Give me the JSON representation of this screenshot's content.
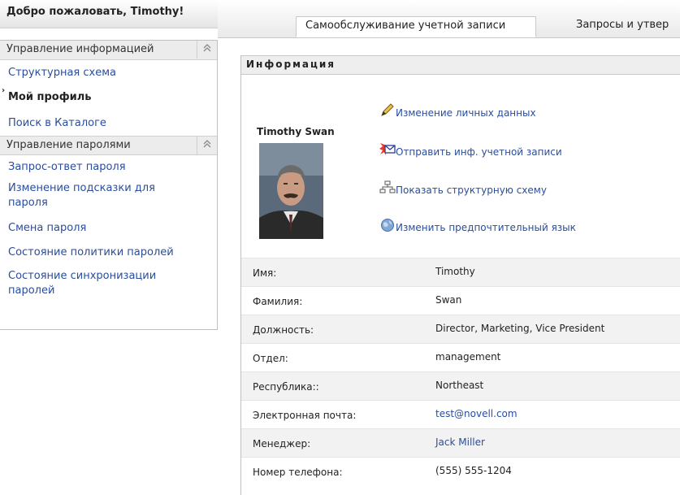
{
  "header": {
    "welcome": "Добро пожаловать, Timothy!",
    "tabs": [
      {
        "label": "Самообслуживание учетной записи",
        "active": true
      },
      {
        "label": "Запросы и утвер",
        "active": false
      }
    ]
  },
  "sidebar": {
    "sections": [
      {
        "title": "Управление информацией",
        "items": [
          {
            "label": "Структурная схема",
            "active": false
          },
          {
            "label": "Мой профиль",
            "active": true
          },
          {
            "label": "Поиск в Каталоге",
            "active": false
          }
        ]
      },
      {
        "title": "Управление паролями",
        "items": [
          {
            "label": "Запрос-ответ пароля"
          },
          {
            "label": "Изменение подсказки для пароля"
          },
          {
            "label": "Смена пароля"
          },
          {
            "label": "Состояние политики паролей"
          },
          {
            "label": "Состояние синхронизации паролей"
          }
        ]
      }
    ],
    "collapse_icon": "chevron-up-double-icon"
  },
  "panel": {
    "title": "Информация",
    "profile_name": "Timothy Swan",
    "actions": [
      {
        "label": "Изменение личных данных",
        "icon": "pencil-icon"
      },
      {
        "label": "Отправить инф. учетной записи",
        "icon": "envelope-icon"
      },
      {
        "label": "Показать структурную схему",
        "icon": "org-chart-icon"
      },
      {
        "label": "Изменить предпочтительный язык",
        "icon": "globe-icon"
      }
    ],
    "fields": [
      {
        "label": "Имя:",
        "value": "Timothy"
      },
      {
        "label": "Фамилия:",
        "value": "Swan"
      },
      {
        "label": "Должность:",
        "value": "Director, Marketing, Vice President"
      },
      {
        "label": "Отдел:",
        "value": "management"
      },
      {
        "label": "Республика::",
        "value": "Northeast"
      },
      {
        "label": "Электронная почта:",
        "value": "test@novell.com",
        "link": true
      },
      {
        "label": "Менеджер:",
        "value": "Jack Miller",
        "link": true
      },
      {
        "label": "Номер телефона:",
        "value": "(555) 555-1204"
      }
    ]
  },
  "colors": {
    "link": "#2a4d9c",
    "header_bg": "#ececec",
    "alt_row": "#f2f2f2"
  }
}
